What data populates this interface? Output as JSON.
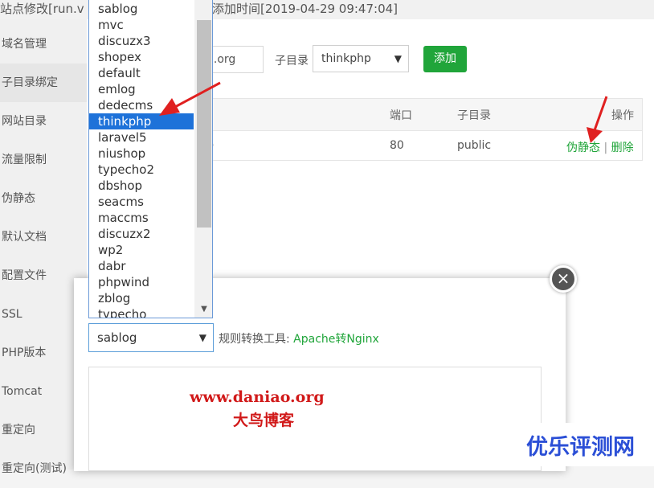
{
  "title": {
    "left": "站点修改[run.v",
    "right": "添加时间[2019-04-29 09:47:04]"
  },
  "sidebar": {
    "items": [
      {
        "label": "域名管理"
      },
      {
        "label": "子目录绑定"
      },
      {
        "label": "网站目录"
      },
      {
        "label": "流量限制"
      },
      {
        "label": "伪静态"
      },
      {
        "label": "默认文档"
      },
      {
        "label": "配置文件"
      },
      {
        "label": "SSL"
      },
      {
        "label": "PHP版本"
      },
      {
        "label": "Tomcat"
      },
      {
        "label": "重定向"
      },
      {
        "label": "重定向(测试)"
      }
    ],
    "active_index": 1
  },
  "form": {
    "domain_value": "g.org",
    "subdir_label": "子目录",
    "subdir_selected": "thinkphp",
    "add_label": "添加"
  },
  "table": {
    "headers": {
      "port": "端口",
      "subdir": "子目录",
      "action": "操作"
    },
    "rows": [
      {
        "domain_fragment": ")",
        "port": "80",
        "subdir": "public",
        "rewrite_link": "伪静态",
        "separator": "|",
        "delete_link": "删除"
      }
    ]
  },
  "dropdown": {
    "options": [
      "sablog",
      "mvc",
      "discuzx3",
      "shopex",
      "default",
      "emlog",
      "dedecms",
      "thinkphp",
      "laravel5",
      "niushop",
      "typecho2",
      "dbshop",
      "seacms",
      "maccms",
      "discuzx2",
      "wp2",
      "dabr",
      "phpwind",
      "zblog",
      "typecho"
    ],
    "highlighted": "thinkphp",
    "scroll_down_glyph": "▼"
  },
  "modal": {
    "rule_selected": "sablog",
    "tool_label": "规则转换工具:",
    "tool_link": "Apache转Nginx",
    "close_glyph": "×"
  },
  "select_arrow": "▼",
  "watermark": {
    "line1": "www.daniao.org",
    "line2": "大鸟博客"
  },
  "corner_watermark": "优乐评测网",
  "colors": {
    "accent_green": "#20a53a",
    "highlight_blue": "#1e72d9",
    "annotation_red": "#e02020",
    "watermark_red": "#d11a1a",
    "corner_blue": "#2b4fd6"
  }
}
